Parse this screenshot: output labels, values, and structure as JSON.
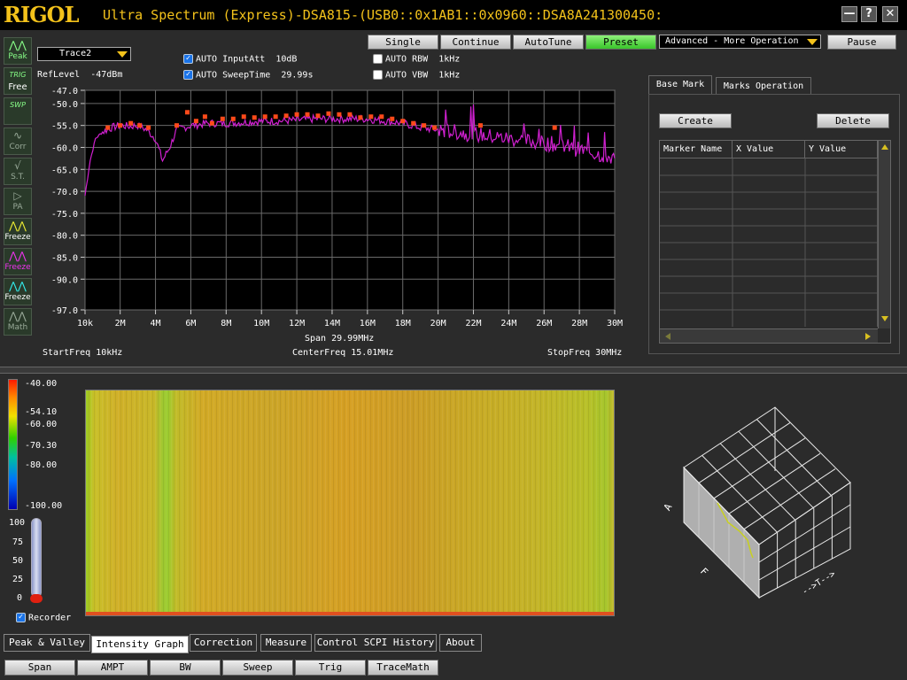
{
  "titlebar": {
    "logo": "RIGOL",
    "title": "Ultra Spectrum (Express)-DSA815-(USB0::0x1AB1::0x0960::DSA8A241300450:",
    "minimize": "—",
    "help": "?",
    "close": "✕"
  },
  "sidebar": [
    {
      "icon": "peak-icon",
      "glyph": "⋀⋀",
      "label": "Peak"
    },
    {
      "icon": "trig-icon",
      "glyph": "TRIG",
      "label": "Free"
    },
    {
      "icon": "swp-icon",
      "glyph": "SWP",
      "label": ""
    },
    {
      "icon": "corr-icon",
      "glyph": "∿",
      "label": "Corr"
    },
    {
      "icon": "st-icon",
      "glyph": "√",
      "label": "S.T."
    },
    {
      "icon": "pa-icon",
      "glyph": "▷",
      "label": "PA"
    },
    {
      "icon": "freeze-yellow-icon",
      "glyph": "⋀⋀",
      "label": "Freeze"
    },
    {
      "icon": "freeze-magenta-icon",
      "glyph": "⋀⋀",
      "label": "Freeze"
    },
    {
      "icon": "freeze-cyan-icon",
      "glyph": "⋀⋀",
      "label": "Freeze"
    },
    {
      "icon": "math-icon",
      "glyph": "⋀⋀",
      "label": "Math"
    }
  ],
  "trace_select": "Trace2",
  "reflevel": {
    "label": "RefLevel",
    "value": "-47dBm"
  },
  "settings": {
    "input_att": {
      "label": "AUTO InputAtt",
      "value": "10dB",
      "checked": true
    },
    "sweep_time": {
      "label": "AUTO SweepTime",
      "value": "29.99s",
      "checked": true
    },
    "rbw": {
      "label": "AUTO RBW",
      "value": "1kHz",
      "checked": false
    },
    "vbw": {
      "label": "AUTO VBW",
      "value": "1kHz",
      "checked": false
    }
  },
  "toolbar": {
    "single": "Single",
    "continue": "Continue",
    "autotune": "AutoTune",
    "preset": "Preset",
    "advanced": "Advanced - More Operation",
    "pause": "Pause"
  },
  "spectrum_footer": {
    "span": "Span  29.99MHz",
    "startfreq": "StartFreq  10kHz",
    "centerfreq": "CenterFreq  15.01MHz",
    "stopfreq": "StopFreq  30MHz"
  },
  "marker_panel": {
    "tabs": [
      "Base Mark",
      "Marks Operation"
    ],
    "create": "Create",
    "delete": "Delete",
    "columns": [
      "Marker Name",
      "X Value",
      "Y Value"
    ]
  },
  "intensity": {
    "scale_labels": [
      "-40.00",
      "-54.10",
      "-60.00",
      "-70.30",
      "-80.00",
      "-100.00"
    ],
    "gauge_labels": [
      "100",
      "75",
      "50",
      "25",
      "0"
    ],
    "recorder": "Recorder",
    "cube_axes": {
      "a": "A",
      "f": "F",
      "t": "-->T-->"
    }
  },
  "bottom_tabs": [
    "Peak & Valley",
    "Intensity Graph",
    "Correction",
    "Measure",
    "Control SCPI History",
    "About"
  ],
  "function_buttons": [
    "Span",
    "AMPT",
    "BW",
    "Sweep",
    "Trig",
    "TraceMath"
  ],
  "chart_data": {
    "type": "line",
    "title": "",
    "xlabel": "",
    "ylabel": "",
    "x_ticks": [
      "10k",
      "2M",
      "4M",
      "6M",
      "8M",
      "10M",
      "12M",
      "14M",
      "16M",
      "18M",
      "20M",
      "22M",
      "24M",
      "26M",
      "28M",
      "30M"
    ],
    "y_ticks": [
      "-47.0",
      "-50.0",
      "-55.0",
      "-60.0",
      "-65.0",
      "-70.0",
      "-75.0",
      "-80.0",
      "-85.0",
      "-90.0",
      "-97.0"
    ],
    "xlim": [
      0.01,
      30
    ],
    "ylim": [
      -97,
      -47
    ],
    "grid": true,
    "series": [
      {
        "color": "#d020d0",
        "x": [
          0.01,
          0.3,
          0.6,
          1.0,
          1.5,
          2.0,
          2.5,
          3.0,
          3.5,
          4.0,
          4.4,
          4.8,
          5.2,
          6.0,
          7.0,
          8.0,
          9.0,
          10.0,
          11.0,
          12.0,
          13.0,
          14.0,
          15.0,
          16.0,
          17.0,
          18.0,
          19.0,
          20.0,
          21.0,
          22.0,
          23.0,
          24.0,
          25.0,
          26.0,
          27.0,
          28.0,
          29.0,
          30.0
        ],
        "y": [
          -71.0,
          -63.0,
          -58.0,
          -56.5,
          -55.5,
          -55.0,
          -55.2,
          -55.0,
          -56.0,
          -58.0,
          -63.0,
          -60.0,
          -56.0,
          -55.0,
          -54.5,
          -54.5,
          -54.3,
          -54.0,
          -54.0,
          -53.8,
          -53.5,
          -53.5,
          -53.5,
          -53.5,
          -54.0,
          -54.5,
          -55.5,
          -56.0,
          -56.5,
          -57.0,
          -57.5,
          -58.0,
          -58.5,
          -59.0,
          -59.5,
          -60.5,
          -61.5,
          -62.5
        ]
      },
      {
        "color": "#ff4a1a",
        "x": [
          1.3,
          2.0,
          2.6,
          3.1,
          3.6,
          5.2,
          5.8,
          6.3,
          6.8,
          7.2,
          7.8,
          8.4,
          9.0,
          9.6,
          10.2,
          10.8,
          11.4,
          12.0,
          12.6,
          13.2,
          13.8,
          14.4,
          15.0,
          15.6,
          16.2,
          16.8,
          17.4,
          18.0,
          18.6,
          19.2,
          19.8,
          22.4,
          26.6
        ],
        "y": [
          -55.5,
          -55.0,
          -54.5,
          -55.0,
          -55.5,
          -55.0,
          -52.0,
          -54.0,
          -53.0,
          -54.5,
          -53.5,
          -53.5,
          -53.0,
          -53.2,
          -53.0,
          -53.0,
          -52.8,
          -52.5,
          -52.5,
          -52.8,
          -52.3,
          -52.5,
          -52.5,
          -53.2,
          -53.0,
          -53.0,
          -53.5,
          -54.0,
          -54.5,
          -55.0,
          -55.5,
          -55.0,
          -55.5
        ]
      }
    ]
  }
}
